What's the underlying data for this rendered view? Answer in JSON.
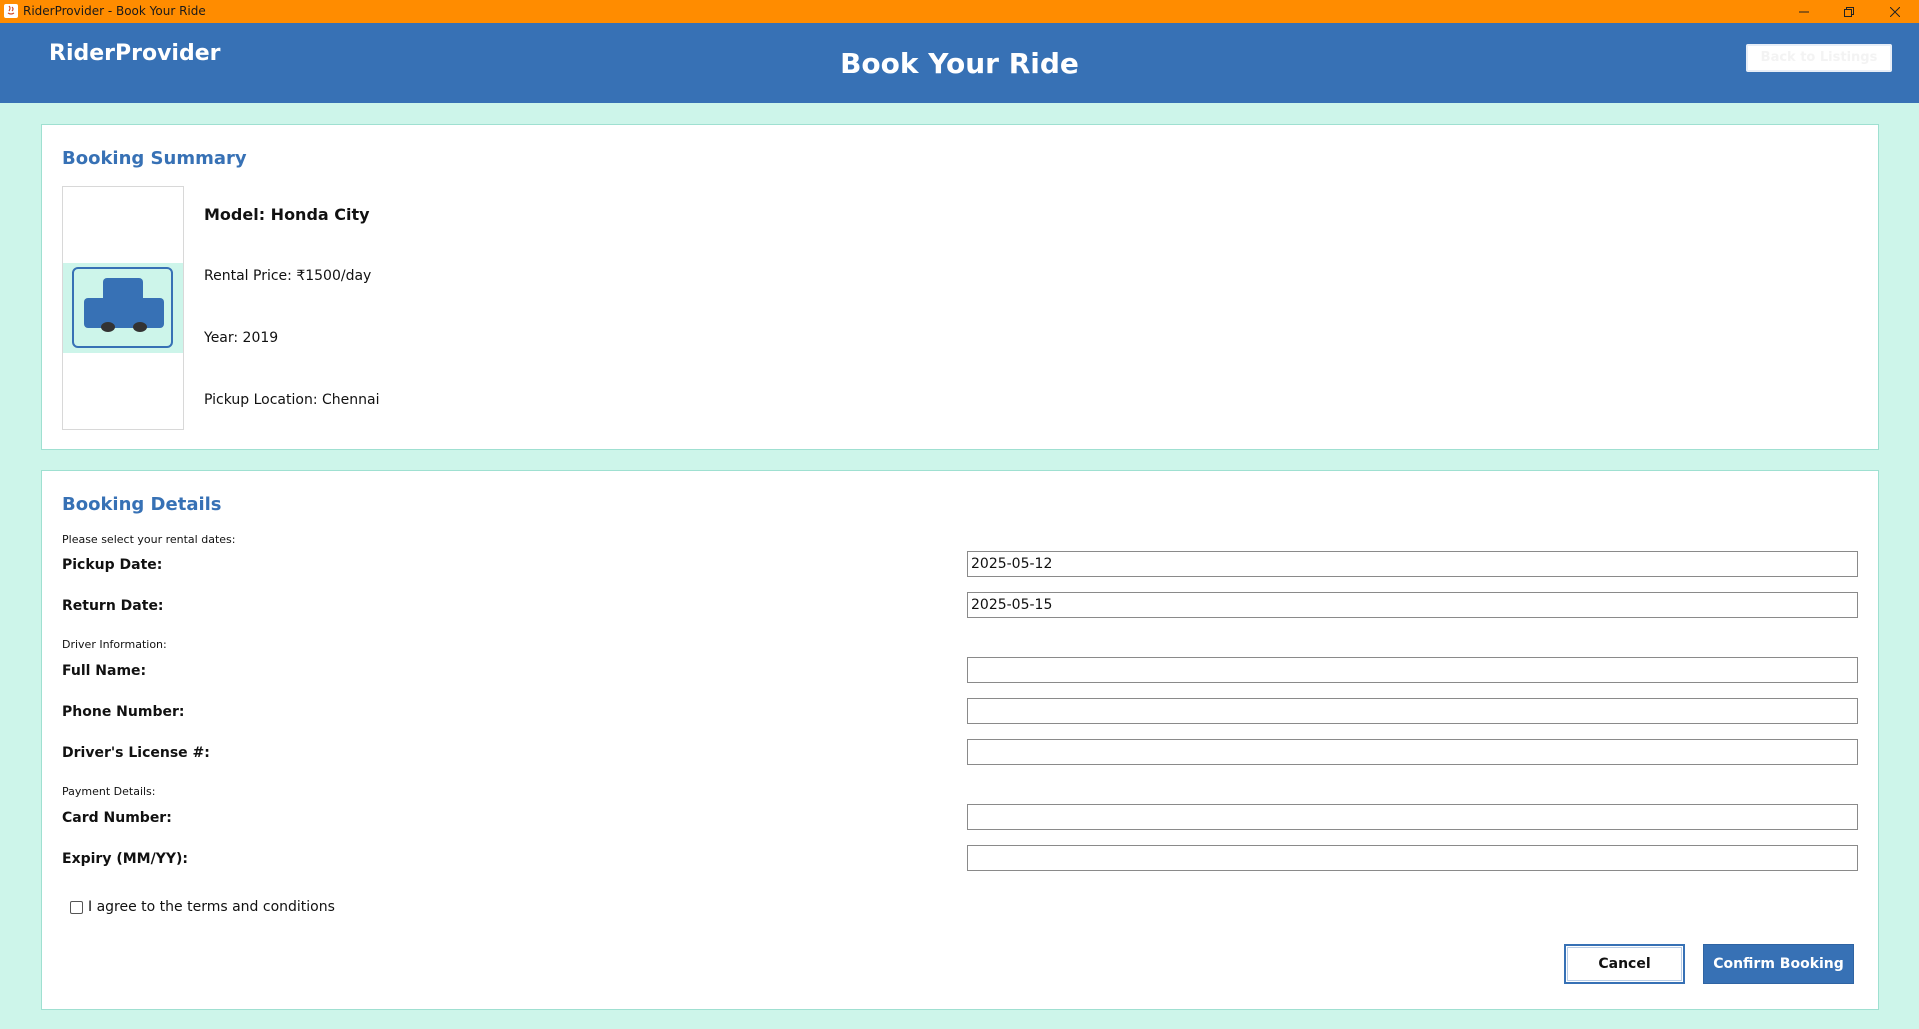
{
  "window": {
    "title": "RiderProvider - Book Your Ride"
  },
  "header": {
    "brand": "RiderProvider",
    "page_title": "Book Your Ride",
    "back_label": "Back to Listings"
  },
  "summary": {
    "heading": "Booking Summary",
    "model": "Model: Honda City",
    "price": "Rental Price: ₹1500/day",
    "year": "Year: 2019",
    "location": "Pickup Location: Chennai"
  },
  "details": {
    "heading": "Booking Details",
    "dates_prompt": "Please select your rental dates:",
    "pickup_label": "Pickup Date:",
    "pickup_value": "2025-05-12",
    "return_label": "Return Date:",
    "return_value": "2025-05-15",
    "driver_section": "Driver Information:",
    "name_label": "Full Name:",
    "name_value": "",
    "phone_label": "Phone Number:",
    "phone_value": "",
    "license_label": "Driver's License #:",
    "license_value": "",
    "payment_section": "Payment Details:",
    "card_label": "Card Number:",
    "card_value": "",
    "expiry_label": "Expiry (MM/YY):",
    "expiry_value": "",
    "terms_label": "I agree to the terms and conditions",
    "terms_checked": false
  },
  "actions": {
    "cancel_label": "Cancel",
    "confirm_label": "Confirm Booking"
  },
  "colors": {
    "accent": "#3771b5",
    "titlebar": "#ff8c00",
    "background": "#cdf5ea"
  }
}
